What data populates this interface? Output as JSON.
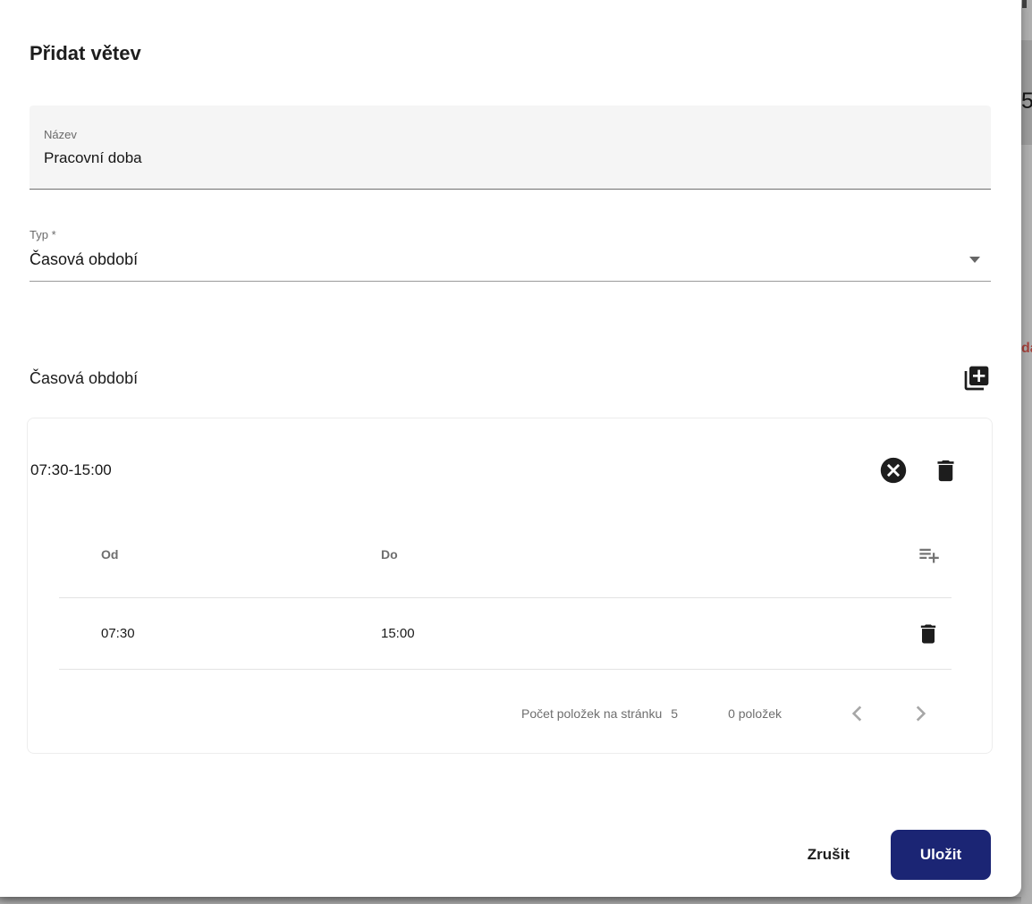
{
  "dialog": {
    "title": "Přidat větev",
    "name_field": {
      "label": "Název",
      "value": "Pracovní doba"
    },
    "type_field": {
      "label": "Typ *",
      "value": "Časová období"
    },
    "section": {
      "title": "Časová období"
    },
    "panel": {
      "header": "07:30-15:00"
    },
    "table": {
      "columns": {
        "od": "Od",
        "do": "Do"
      },
      "rows": [
        {
          "od": "07:30",
          "do": "15:00"
        }
      ]
    },
    "paginator": {
      "page_size_label": "Počet položek na stránku",
      "page_size": "5",
      "range": "0 položek"
    },
    "actions": {
      "cancel": "Zrušit",
      "save": "Uložit"
    }
  },
  "icons": {
    "section_add": "library-add-icon",
    "panel_clear": "cancel-icon",
    "panel_delete": "trash-icon",
    "table_add_row": "playlist-add-icon",
    "prev_page": "chevron-left-icon",
    "next_page": "chevron-right-icon",
    "type_dropdown": "caret-down-icon"
  },
  "colors": {
    "save_button_bg": "#1b2574",
    "backdrop": "#afafaf",
    "field_fill": "#f5f5f5",
    "clipped_red_text": "#a5423c"
  },
  "background": {
    "clipped_text_top": "5",
    "clipped_text_red": "da"
  }
}
